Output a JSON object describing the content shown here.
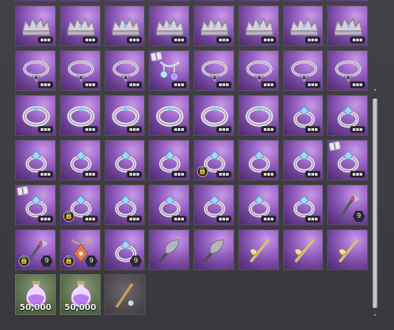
{
  "inventory": {
    "rows": [
      [
        {
          "kind": "crown-icon",
          "bg": "purple",
          "dots": true
        },
        {
          "kind": "crown-icon",
          "bg": "purple",
          "dots": true
        },
        {
          "kind": "crown-icon",
          "bg": "purple",
          "dots": true
        },
        {
          "kind": "crown-icon",
          "bg": "purple",
          "dots": true
        },
        {
          "kind": "crown-icon",
          "bg": "purple",
          "dots": true
        },
        {
          "kind": "crown-icon",
          "bg": "purple",
          "dots": true
        },
        {
          "kind": "crown-icon",
          "bg": "purple",
          "dots": true
        },
        {
          "kind": "crown-icon",
          "bg": "purple",
          "dots": true
        }
      ],
      [
        {
          "kind": "crown-icon",
          "bg": "purple",
          "dots": true
        },
        {
          "kind": "crown-icon",
          "bg": "purple",
          "dots": true
        },
        {
          "kind": "crown-icon",
          "bg": "purple",
          "dots": true
        },
        {
          "kind": "crown-icon",
          "bg": "purple",
          "dots": true
        },
        {
          "kind": "crown-icon",
          "bg": "purple",
          "dots": true
        },
        {
          "kind": "crown-icon",
          "bg": "purple",
          "dots": true
        },
        {
          "kind": "crown-icon",
          "bg": "purple",
          "dots": true
        },
        {
          "kind": "crown-icon",
          "bg": "purple",
          "dots": true
        }
      ],
      [
        {
          "kind": "necklace-icon",
          "bg": "purple",
          "dots": true
        },
        {
          "kind": "necklace-icon",
          "bg": "purple",
          "dots": true
        },
        {
          "kind": "necklace-icon",
          "bg": "purple",
          "dots": true
        },
        {
          "kind": "gem-chain-icon",
          "bg": "purple",
          "dots": true,
          "book": true
        },
        {
          "kind": "necklace-icon",
          "bg": "purple",
          "dots": true
        },
        {
          "kind": "necklace-icon",
          "bg": "purple",
          "dots": true
        },
        {
          "kind": "necklace-icon",
          "bg": "purple",
          "dots": true
        },
        {
          "kind": "necklace-icon",
          "bg": "purple",
          "dots": true
        }
      ],
      [
        {
          "kind": "bracelet-icon",
          "bg": "purple",
          "dots": true
        },
        {
          "kind": "bracelet-icon",
          "bg": "purple",
          "dots": true
        },
        {
          "kind": "bracelet-icon",
          "bg": "purple",
          "dots": true
        },
        {
          "kind": "bracelet-icon",
          "bg": "purple",
          "dots": true
        },
        {
          "kind": "bracelet-icon",
          "bg": "purple",
          "dots": true
        },
        {
          "kind": "bracelet-icon",
          "bg": "purple",
          "dots": true
        },
        {
          "kind": "ring-icon",
          "bg": "purple",
          "dots": true
        },
        {
          "kind": "ring-icon",
          "bg": "purple",
          "dots": true
        }
      ],
      [
        {
          "kind": "ring-icon",
          "bg": "purple",
          "dots": true
        },
        {
          "kind": "ring-icon",
          "bg": "purple",
          "dots": true
        },
        {
          "kind": "ring-icon",
          "bg": "purple",
          "dots": true
        },
        {
          "kind": "ring-icon",
          "bg": "purple",
          "dots": true
        },
        {
          "kind": "ring-icon",
          "bg": "purple",
          "dots": true,
          "lock": true
        },
        {
          "kind": "ring-icon",
          "bg": "purple",
          "dots": true
        },
        {
          "kind": "ring-icon",
          "bg": "purple",
          "dots": true
        },
        {
          "kind": "ring-icon",
          "bg": "purple",
          "dots": true,
          "book": true
        }
      ],
      [
        {
          "kind": "ring-icon",
          "bg": "purple",
          "dots": true,
          "book": true
        },
        {
          "kind": "ring-icon",
          "bg": "purple",
          "dots": true,
          "lock": true
        },
        {
          "kind": "ring-icon",
          "bg": "purple",
          "dots": true
        },
        {
          "kind": "ring-icon",
          "bg": "purple",
          "dots": true
        },
        {
          "kind": "ring-icon",
          "bg": "purple",
          "dots": true
        },
        {
          "kind": "ring-icon",
          "bg": "purple",
          "dots": true
        },
        {
          "kind": "ring-icon",
          "bg": "purple",
          "dots": true
        },
        {
          "kind": "staff-icon",
          "bg": "purple",
          "hex": "9"
        }
      ],
      [
        {
          "kind": "staff-icon",
          "bg": "purple",
          "lock": true,
          "hex": "9"
        },
        {
          "kind": "pendant-icon",
          "bg": "purple",
          "lock": true,
          "hex": "9"
        },
        {
          "kind": "ring-icon",
          "bg": "purple",
          "hex": "9"
        },
        {
          "kind": "feather-icon",
          "bg": "purple"
        },
        {
          "kind": "feather-icon",
          "bg": "purple"
        },
        {
          "kind": "flute-icon",
          "bg": "purple"
        },
        {
          "kind": "flute-icon",
          "bg": "purple"
        },
        {
          "kind": "flute-icon",
          "bg": "purple"
        }
      ],
      [
        {
          "kind": "potion-icon",
          "bg": "green",
          "qty": "50,000"
        },
        {
          "kind": "potion-icon",
          "bg": "green",
          "qty": "50,000"
        },
        {
          "kind": "stick-icon",
          "bg": "gray"
        }
      ]
    ]
  },
  "scrollbar": {
    "up_symbol": "⌃",
    "down_symbol": "⌄"
  }
}
